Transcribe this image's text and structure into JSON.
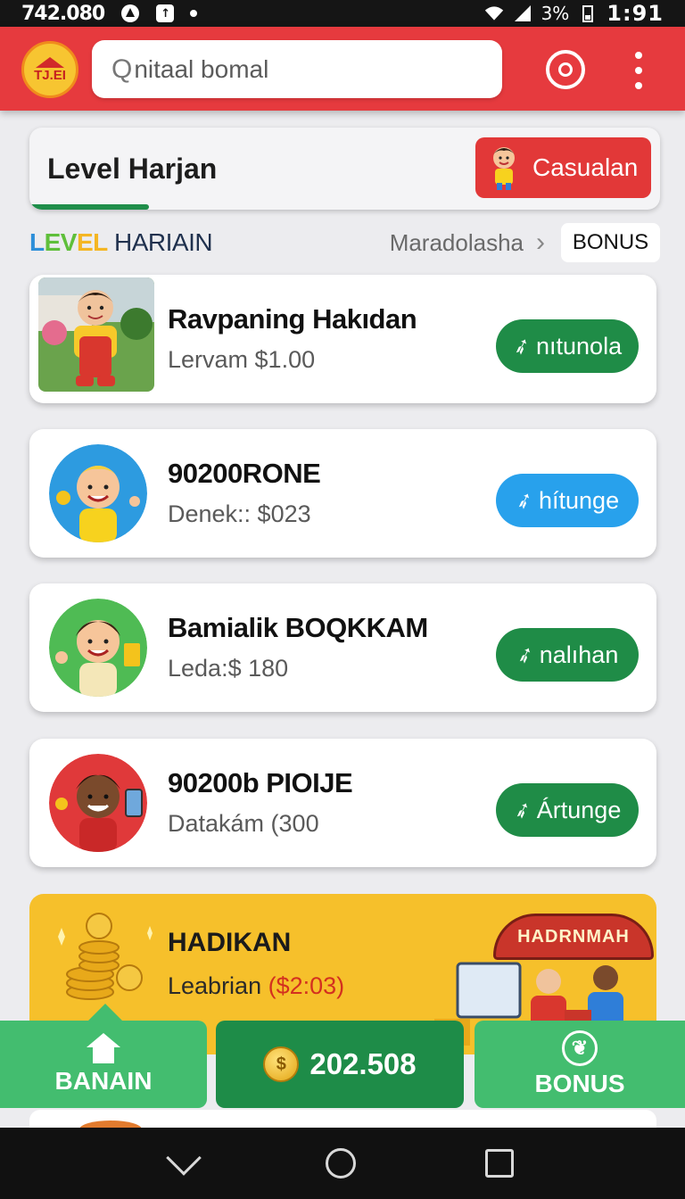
{
  "status_bar": {
    "left_text": "742.080",
    "battery": "3%",
    "clock": "1:91"
  },
  "header": {
    "logo_text": "TJ.EI",
    "search_glyph": "Q",
    "search_value": "nitaal bomal"
  },
  "level_card": {
    "title": "Level Harjan",
    "button_label": "Casualan",
    "progress_percent": 19
  },
  "section": {
    "title_parts": [
      "L",
      "EV",
      "EL",
      " HARIAIN"
    ],
    "link_label": "Maradolasha",
    "chip_label": "BONUS"
  },
  "tasks": [
    {
      "title": "Ravpaning Hakıdan",
      "subtitle": "Lervam $1.00",
      "action_label": "nıtunola",
      "action_color": "#1f8c47"
    },
    {
      "title": "90200RONE",
      "subtitle": "Denek:: $023",
      "action_label": "hítunge",
      "action_color": "#28a1ec"
    },
    {
      "title": "Bamialik BOQKKAM",
      "subtitle": "Leda:$ 180",
      "action_label": "nalıhan",
      "action_color": "#1f8c47"
    },
    {
      "title": "90200b PIOIJE",
      "subtitle": "Datakám (300",
      "action_label": "Ártunge",
      "action_color": "#1f8c47"
    }
  ],
  "banner": {
    "title": "HADIKAN",
    "sub_prefix": "Leabrian ",
    "sub_amount": "($2:03)",
    "ribbon_text": "HADRNMAH"
  },
  "bottom_nav": {
    "left_label": "BANAIN",
    "center_value": "202.508",
    "coin_symbol": "$",
    "right_label": "BONUS"
  }
}
